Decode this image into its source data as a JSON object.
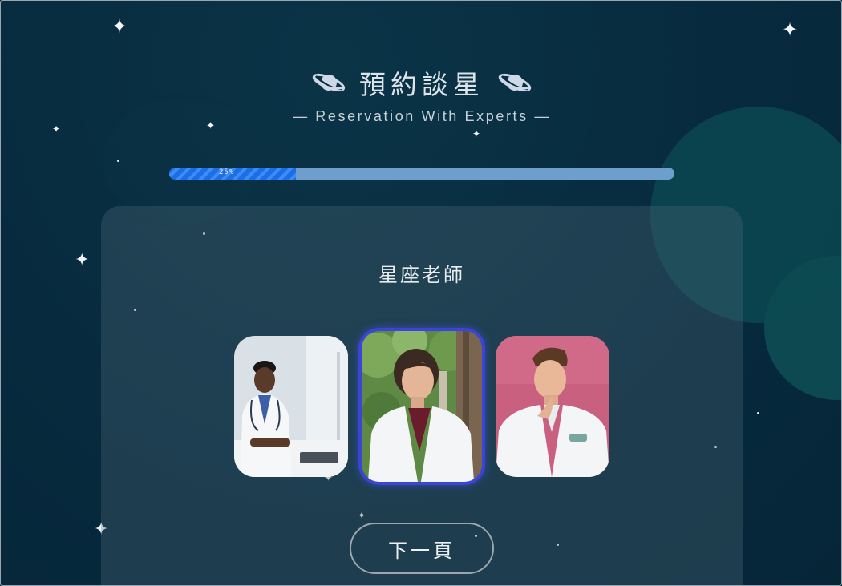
{
  "header": {
    "title": "預約談星",
    "subtitle": "— Reservation With Experts —"
  },
  "progress": {
    "percent": 25,
    "label": "25%"
  },
  "card": {
    "title": "星座老師",
    "experts": [
      {
        "id": "expert-1",
        "selected": false
      },
      {
        "id": "expert-2",
        "selected": true
      },
      {
        "id": "expert-3",
        "selected": false
      }
    ],
    "next_label": "下一頁"
  },
  "colors": {
    "background": "#072a3e",
    "progress_fill": "#1a6fe6",
    "progress_track": "#6d9ecd",
    "selected_border": "#3b44d6"
  },
  "icons": {
    "title_decoration": "planet-icon",
    "stars": "sparkle-icon"
  }
}
